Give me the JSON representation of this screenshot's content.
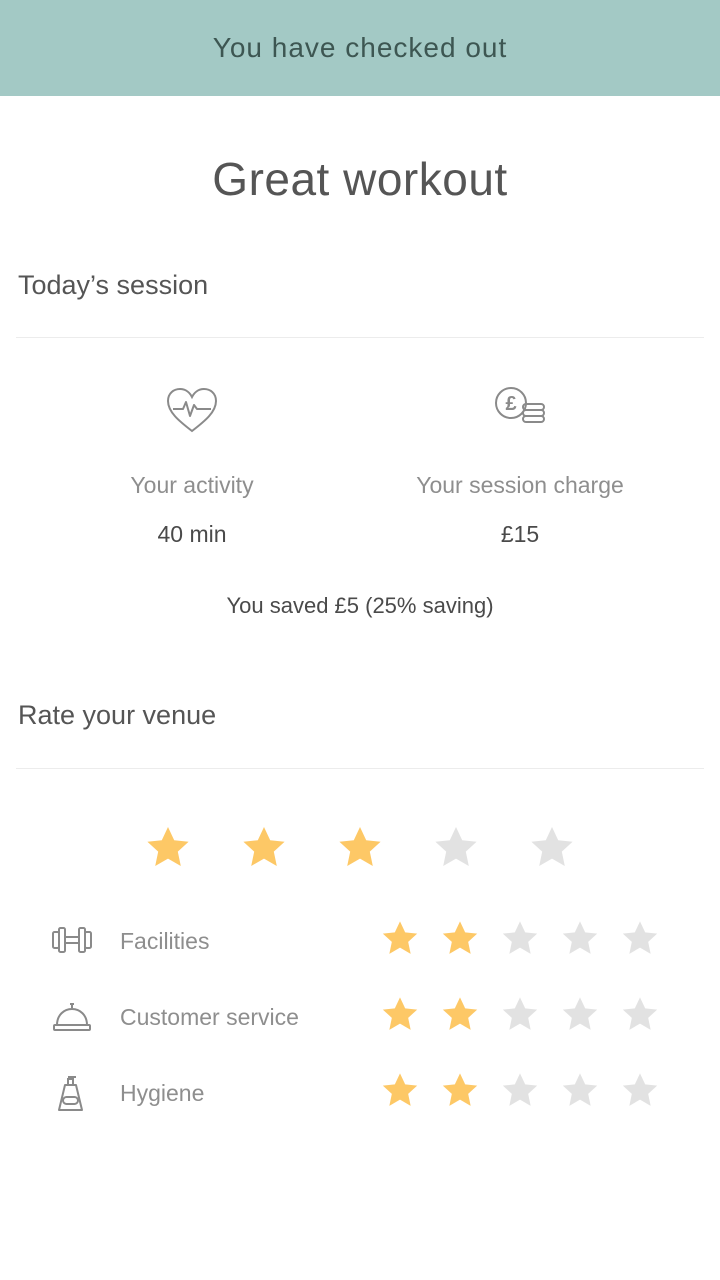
{
  "banner": {
    "text": "You have checked out"
  },
  "title": "Great workout",
  "session": {
    "heading": "Today’s session",
    "activity": {
      "icon": "heartbeat-icon",
      "label": "Your activity",
      "value": "40 min"
    },
    "charge": {
      "icon": "pound-coins-icon",
      "label": "Your session charge",
      "value": "£15"
    },
    "saving_text": "You saved £5 (25% saving)"
  },
  "rating": {
    "heading": "Rate your venue",
    "overall": 3,
    "max": 5,
    "categories": [
      {
        "icon": "dumbbell-icon",
        "label": "Facilities",
        "rating": 2
      },
      {
        "icon": "service-bell-icon",
        "label": "Customer service",
        "rating": 2
      },
      {
        "icon": "soap-dispenser-icon",
        "label": "Hygiene",
        "rating": 2
      }
    ]
  },
  "colors": {
    "banner_bg": "#a3c9c5",
    "star_filled": "#fdc866",
    "star_empty": "#e2e2e2"
  }
}
